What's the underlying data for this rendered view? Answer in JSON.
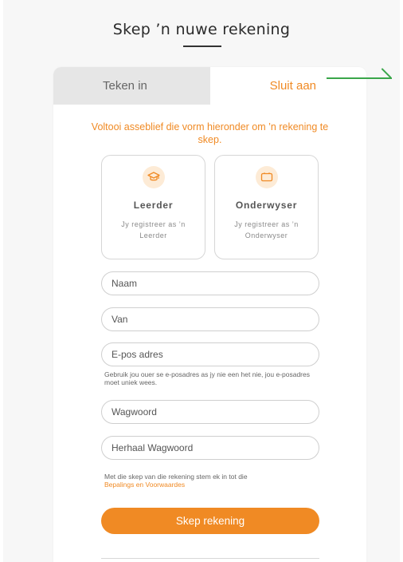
{
  "page": {
    "title": "Skep ’n nuwe rekening"
  },
  "tabs": [
    {
      "label": "Teken in",
      "active": false
    },
    {
      "label": "Sluit aan",
      "active": true
    }
  ],
  "intro_text": "Voltooi asseblief die vorm hieronder om ’n rekening te skep.",
  "roles": [
    {
      "icon": "graduation-cap-icon",
      "title": "Leerder",
      "description": "Jy registreer as ’n Leerder"
    },
    {
      "icon": "whiteboard-icon",
      "title": "Onderwyser",
      "description": "Jy registreer as ’n Onderwyser"
    }
  ],
  "form": {
    "name_placeholder": "Naam",
    "surname_placeholder": "Van",
    "email_placeholder": "E-pos adres",
    "email_hint": "Gebruik jou ouer se e-posadres as jy nie een het nie, jou e-posadres moet uniek wees.",
    "password_placeholder": "Wagwoord",
    "repeat_password_placeholder": "Herhaal Wagwoord",
    "terms_prefix": "Met die skep van die rekening stem ek in tot die",
    "terms_link": "Bepalings en Voorwaardes",
    "submit_label": "Skep rekening"
  },
  "colors": {
    "accent": "#f08a24",
    "connector": "#3aa64a",
    "inactive_tab": "#e6e6e6"
  }
}
